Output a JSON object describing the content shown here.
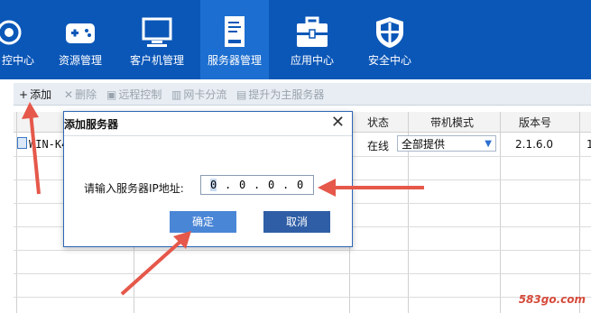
{
  "nav": {
    "items": [
      {
        "label": "控中心",
        "icon": "monitor-eye-icon"
      },
      {
        "label": "资源管理",
        "icon": "gamepad-icon"
      },
      {
        "label": "客户机管理",
        "icon": "desktop-icon"
      },
      {
        "label": "服务器管理",
        "icon": "server-icon"
      },
      {
        "label": "应用中心",
        "icon": "toolbox-icon"
      },
      {
        "label": "安全中心",
        "icon": "shield-icon"
      }
    ]
  },
  "toolbar": {
    "add": "添加",
    "delete": "删除",
    "remote": "远程控制",
    "nic": "网卡分流",
    "promote": "提升为主服务器"
  },
  "table": {
    "columns": [
      "状态",
      "带机模式",
      "版本号"
    ],
    "row": {
      "name": "WIN-K4",
      "status": "在线",
      "mode": "全部提供",
      "version": "2.1.6.0",
      "extra": "1"
    }
  },
  "dialog": {
    "title": "添加服务器",
    "ip_label": "请输入服务器IP地址:",
    "ip_octets": [
      "0",
      "0",
      "0",
      "0"
    ],
    "ok": "确定",
    "cancel": "取消"
  },
  "watermark": "583go.com",
  "colors": {
    "nav_bg": "#0b57b8",
    "arrow": "#e5584a",
    "ok_button": "#4a86d6",
    "cancel_button": "#2f5ea6"
  }
}
